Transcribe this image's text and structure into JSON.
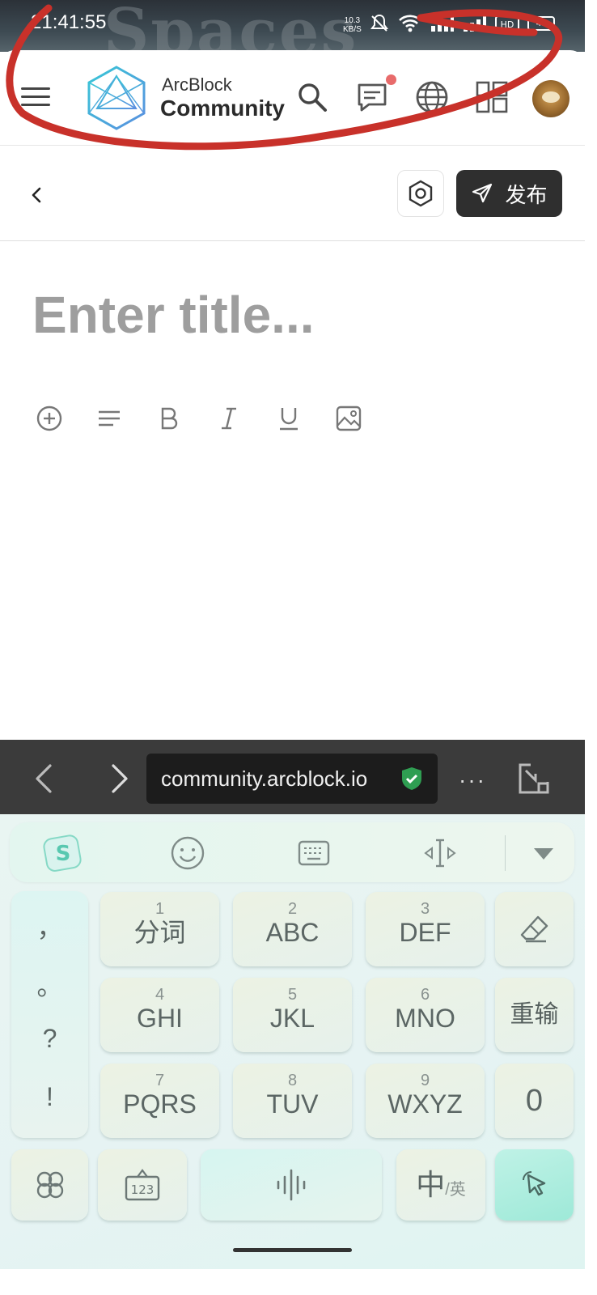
{
  "status_bar": {
    "background_word": "Spaces",
    "time": "21:41:55",
    "net_speed_value": "10.3",
    "net_speed_unit": "KB/S",
    "battery": "49",
    "icons": [
      "mute-icon",
      "wifi-icon",
      "signal-icon",
      "signal-icon",
      "hd-icon",
      "battery-icon"
    ]
  },
  "header": {
    "brand_top": "ArcBlock",
    "brand_main": "Community",
    "icons": [
      "menu-icon",
      "search-icon",
      "chat-icon",
      "globe-icon",
      "apps-icon"
    ],
    "notification_dot_color": "#e86b6b"
  },
  "editor": {
    "publish_label": "发布",
    "title_placeholder": "Enter title...",
    "format_tools": [
      "plus-circle-icon",
      "paragraph-icon",
      "bold-icon",
      "italic-icon",
      "underline-icon",
      "image-icon"
    ]
  },
  "browser": {
    "url": "community.arcblock.io",
    "more": "···",
    "secure_color": "#2f9e52"
  },
  "keyboard": {
    "punctuation": [
      "，",
      "。",
      "?",
      "!"
    ],
    "keys": [
      {
        "num": "1",
        "label": "分词"
      },
      {
        "num": "2",
        "label": "ABC"
      },
      {
        "num": "3",
        "label": "DEF"
      },
      {
        "num": "4",
        "label": "GHI"
      },
      {
        "num": "5",
        "label": "JKL"
      },
      {
        "num": "6",
        "label": "MNO"
      },
      {
        "num": "7",
        "label": "PQRS"
      },
      {
        "num": "8",
        "label": "TUV"
      },
      {
        "num": "9",
        "label": "WXYZ"
      }
    ],
    "reinput_label": "重输",
    "zero_label": "0",
    "lang_main": "中",
    "lang_sub": "英",
    "lang_divider": "/"
  },
  "colors": {
    "annotation_stroke": "#c8312a",
    "publish_bg": "#2f2f2f",
    "placeholder_text": "#9e9e9e"
  }
}
